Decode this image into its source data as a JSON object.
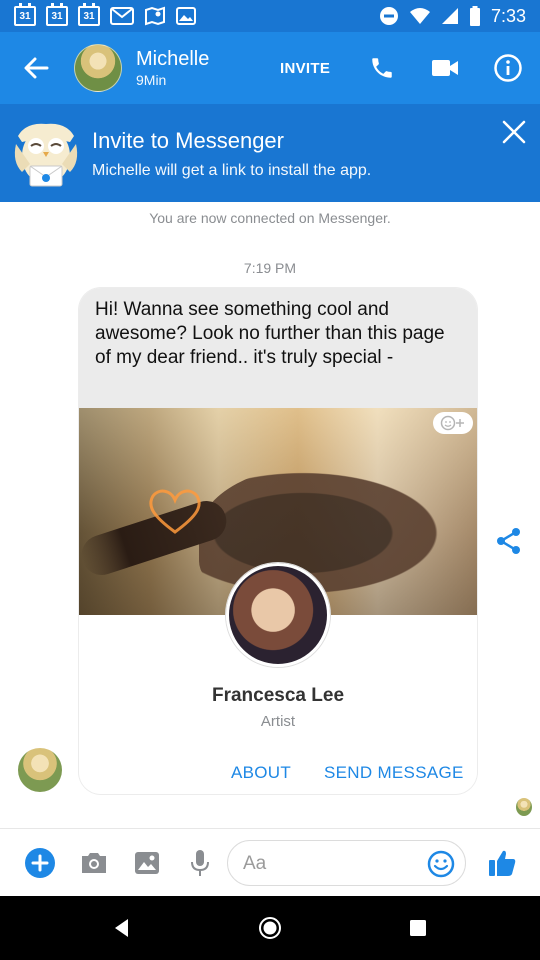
{
  "status_bar": {
    "calendar_day": "31",
    "time": "7:33",
    "icons": [
      "calendar-icon",
      "calendar-icon",
      "calendar-icon",
      "gmail-icon",
      "maps-icon",
      "photos-icon",
      "do-not-disturb-icon",
      "wifi-icon",
      "signal-icon",
      "battery-icon"
    ]
  },
  "header": {
    "contact_name": "Michelle",
    "contact_status": "9Min",
    "invite_label": "INVITE",
    "background_color": "#1e88e5"
  },
  "invite_banner": {
    "title": "Invite to Messenger",
    "subtitle": "Michelle will get a link to install the app.",
    "background_color": "#1976d2"
  },
  "chat": {
    "system_message": "You are now connected on Messenger.",
    "timestamp": "7:19 PM",
    "message_text": "Hi! Wanna see something cool and awesome? Look no further than this page of my dear friend.. it's truly special -",
    "card": {
      "name": "Francesca Lee",
      "role": "Artist",
      "actions": [
        "ABOUT",
        "SEND MESSAGE"
      ]
    }
  },
  "composer": {
    "placeholder": "Aa",
    "accent_color": "#1e88e5"
  }
}
